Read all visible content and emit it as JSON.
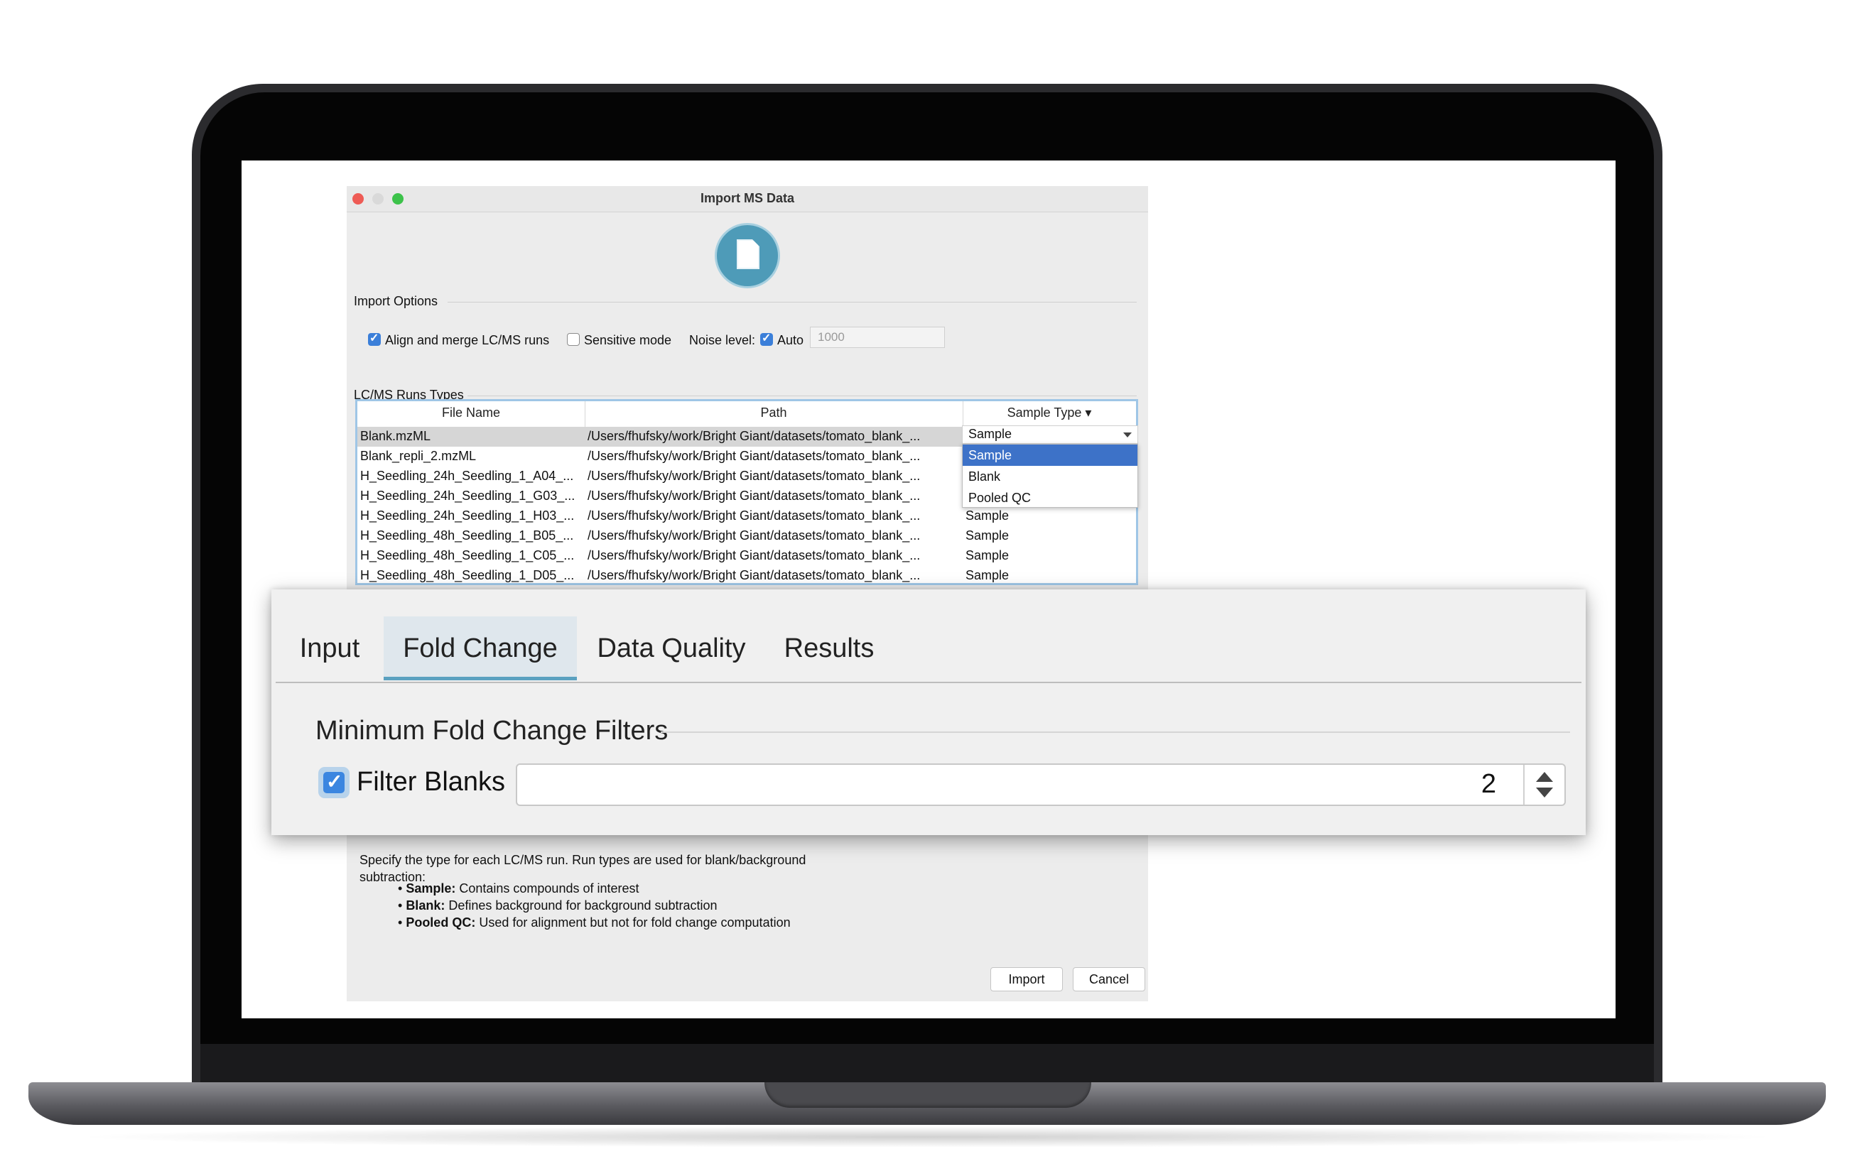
{
  "dialog": {
    "title": "Import MS Data",
    "import_options_label": "Import Options",
    "options": {
      "align_merge": {
        "label": "Align and merge LC/MS runs",
        "checked": true
      },
      "sensitive_mode": {
        "label": "Sensitive mode",
        "checked": false
      },
      "noise_level_label": "Noise level:",
      "auto": {
        "label": "Auto",
        "checked": true
      },
      "noise_value": "1000"
    },
    "runs_label": "LC/MS Runs Types",
    "table": {
      "columns": [
        "File Name",
        "Path",
        "Sample Type ▾"
      ],
      "rows": [
        {
          "file": "Blank.mzML",
          "path": "/Users/fhufsky/work/Bright Giant/datasets/tomato_blank_...",
          "type": "Sample"
        },
        {
          "file": "Blank_repli_2.mzML",
          "path": "/Users/fhufsky/work/Bright Giant/datasets/tomato_blank_...",
          "type": ""
        },
        {
          "file": "H_Seedling_24h_Seedling_1_A04_...",
          "path": "/Users/fhufsky/work/Bright Giant/datasets/tomato_blank_...",
          "type": ""
        },
        {
          "file": "H_Seedling_24h_Seedling_1_G03_...",
          "path": "/Users/fhufsky/work/Bright Giant/datasets/tomato_blank_...",
          "type": ""
        },
        {
          "file": "H_Seedling_24h_Seedling_1_H03_...",
          "path": "/Users/fhufsky/work/Bright Giant/datasets/tomato_blank_...",
          "type": "Sample"
        },
        {
          "file": "H_Seedling_48h_Seedling_1_B05_...",
          "path": "/Users/fhufsky/work/Bright Giant/datasets/tomato_blank_...",
          "type": "Sample"
        },
        {
          "file": "H_Seedling_48h_Seedling_1_C05_...",
          "path": "/Users/fhufsky/work/Bright Giant/datasets/tomato_blank_...",
          "type": "Sample"
        },
        {
          "file": "H_Seedling_48h_Seedling_1_D05_...",
          "path": "/Users/fhufsky/work/Bright Giant/datasets/tomato_blank_...",
          "type": "Sample"
        }
      ]
    },
    "combo_value": "Sample",
    "dropdown_options": [
      "Sample",
      "Blank",
      "Pooled QC"
    ],
    "help_text": "Specify the type for each LC/MS run. Run types are used for blank/background subtraction:",
    "bullets": [
      {
        "term": "Sample:",
        "desc": "Contains compounds of interest"
      },
      {
        "term": "Blank:",
        "desc": "Defines background for background subtraction"
      },
      {
        "term": "Pooled QC:",
        "desc": "Used for alignment but not for fold change computation"
      }
    ],
    "import_button": "Import",
    "cancel_button": "Cancel"
  },
  "panel": {
    "tabs": [
      "Input",
      "Fold Change",
      "Data Quality",
      "Results"
    ],
    "active_tab": "Fold Change",
    "group_title": "Minimum Fold Change Filters",
    "filter_blanks": {
      "label": "Filter Blanks",
      "checked": true
    },
    "spinner_value": "2"
  },
  "colors": {
    "accent": "#3b86e0",
    "tab_underline": "#5aa1c0",
    "selection": "#3d72c8"
  }
}
